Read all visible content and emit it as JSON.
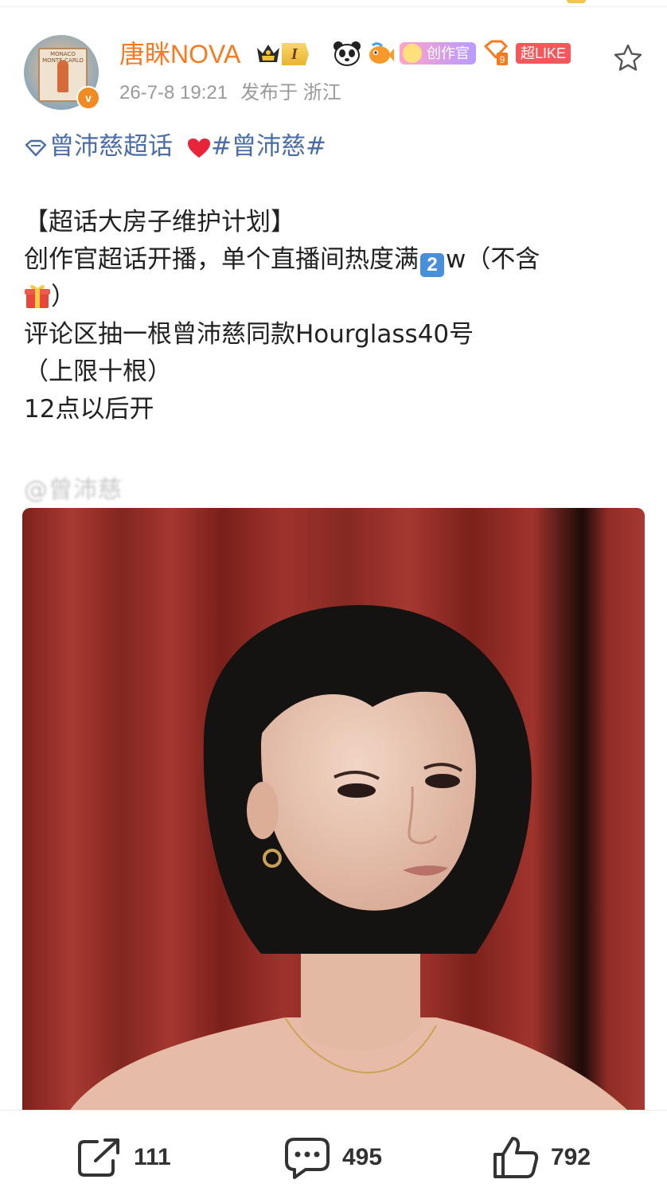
{
  "header": {
    "username": "唐眯NOVA",
    "level_badge": "I",
    "creator_badge": "创作官",
    "super_like_badge": "超LIKE",
    "avatar_poster_text": "MONACO MONTE-CARLO",
    "verified_mark": "v",
    "timestamp": "26-7-8 19:21",
    "location": "发布于 浙江"
  },
  "post": {
    "supertopic": "曾沛慈超话",
    "hashtag": "#曾沛慈#",
    "line1": "【超话大房子维护计划】",
    "line2_pre": "创作官超话开播，单个直播间热度满",
    "line2_key": "2",
    "line2_post": "w（不含",
    "line3_post": "）",
    "line4": "评论区抽一根曾沛慈同款Hourglass40号",
    "line5": "（上限十根）",
    "line6": "12点以后开",
    "mention": "@曾沛慈"
  },
  "actions": {
    "repost_count": "111",
    "comment_count": "495",
    "like_count": "792"
  },
  "colors": {
    "username": "#f57a22",
    "link": "#4a6da7",
    "meta": "#9a9a9a",
    "curtain": "#8f2a24"
  },
  "icons": {
    "crown": "crown-icon",
    "panda": "panda-icon",
    "fish": "fish-icon",
    "gem": "gem-icon",
    "star": "star-icon",
    "gift": "gift-icon",
    "heart": "heart-icon",
    "repost": "repost-icon",
    "comment": "comment-icon",
    "like": "thumbs-up-icon"
  }
}
